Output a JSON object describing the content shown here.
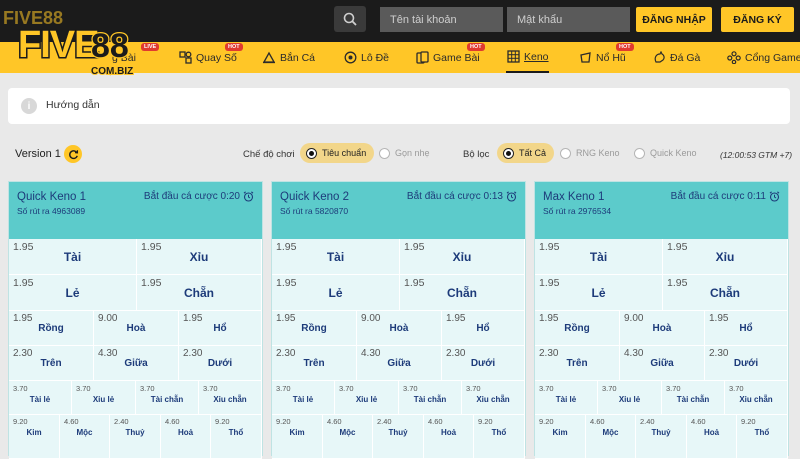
{
  "brand": {
    "logo_text": "FIVE88",
    "logo_domain": "COM.BIZ"
  },
  "header": {
    "username_placeholder": "Tên tài khoản",
    "password_placeholder": "Mật khẩu",
    "login_label": "ĐĂNG NHẬP",
    "register_label": "ĐĂNG KÝ"
  },
  "nav": {
    "items": [
      {
        "label": "g Bài",
        "icon": "cards-icon",
        "badge": "LIVE"
      },
      {
        "label": "Quay Số",
        "icon": "lottery-icon",
        "badge": "HOT"
      },
      {
        "label": "Bắn Cá",
        "icon": "fish-icon"
      },
      {
        "label": "Lô Đề",
        "icon": "lotto-ball-icon"
      },
      {
        "label": "Game Bài",
        "icon": "card-game-icon",
        "badge": "HOT"
      },
      {
        "label": "Keno",
        "icon": "keno-grid-icon",
        "active": true
      },
      {
        "label": "Nổ Hũ",
        "icon": "slot-icon",
        "badge": "HOT"
      },
      {
        "label": "Đá Gà",
        "icon": "rooster-icon"
      },
      {
        "label": "Cổng Game",
        "icon": "gamepad-icon"
      }
    ]
  },
  "guide": {
    "label": "Hướng dẫn",
    "icon": "info-icon"
  },
  "filters": {
    "version_label": "Version 1",
    "mode_label": "Chế độ chơi",
    "mode_options": [
      "Tiêu chuẩn",
      "Gọn nhẹ"
    ],
    "mode_selected": "Tiêu chuẩn",
    "filter_label": "Bộ lọc",
    "filter_options": [
      "Tất Cả",
      "RNG Keno",
      "Quick Keno"
    ],
    "filter_selected": "Tất Cả",
    "clock": "(12:00:53 GTM +7)"
  },
  "colors": {
    "accent": "#ffc627",
    "header_bg": "#1b1b1b",
    "card_head": "#5ccbcb",
    "card_body": "#e7f7f8",
    "label_text": "#1d3b7a",
    "badge_red": "#e03a2f"
  },
  "games": [
    {
      "name": "Quick Keno 1",
      "draw": "Số rút ra 4963089",
      "timer": "Bắt đầu cá cược 0:20",
      "row1": [
        {
          "odd": "1.95",
          "label": "Tài"
        },
        {
          "odd": "1.95",
          "label": "Xỉu"
        }
      ],
      "row2": [
        {
          "odd": "1.95",
          "label": "Lẻ"
        },
        {
          "odd": "1.95",
          "label": "Chẵn"
        }
      ],
      "row3": [
        {
          "odd": "1.95",
          "label": "Rồng"
        },
        {
          "odd": "9.00",
          "label": "Hoà"
        },
        {
          "odd": "1.95",
          "label": "Hổ"
        }
      ],
      "row4": [
        {
          "odd": "2.30",
          "label": "Trên"
        },
        {
          "odd": "4.30",
          "label": "Giữa"
        },
        {
          "odd": "2.30",
          "label": "Dưới"
        }
      ],
      "row5": [
        {
          "odd": "3.70",
          "label": "Tài lẻ"
        },
        {
          "odd": "3.70",
          "label": "Xỉu lẻ"
        },
        {
          "odd": "3.70",
          "label": "Tài chẵn"
        },
        {
          "odd": "3.70",
          "label": "Xỉu chẵn"
        }
      ],
      "row6": [
        {
          "odd": "9.20",
          "label": "Kim"
        },
        {
          "odd": "4.60",
          "label": "Mộc"
        },
        {
          "odd": "2.40",
          "label": "Thuỷ"
        },
        {
          "odd": "4.60",
          "label": "Hoả"
        },
        {
          "odd": "9.20",
          "label": "Thổ"
        }
      ]
    },
    {
      "name": "Quick Keno 2",
      "draw": "Số rút ra 5820870",
      "timer": "Bắt đầu cá cược 0:13",
      "row1": [
        {
          "odd": "1.95",
          "label": "Tài"
        },
        {
          "odd": "1.95",
          "label": "Xỉu"
        }
      ],
      "row2": [
        {
          "odd": "1.95",
          "label": "Lẻ"
        },
        {
          "odd": "1.95",
          "label": "Chẵn"
        }
      ],
      "row3": [
        {
          "odd": "1.95",
          "label": "Rồng"
        },
        {
          "odd": "9.00",
          "label": "Hoà"
        },
        {
          "odd": "1.95",
          "label": "Hổ"
        }
      ],
      "row4": [
        {
          "odd": "2.30",
          "label": "Trên"
        },
        {
          "odd": "4.30",
          "label": "Giữa"
        },
        {
          "odd": "2.30",
          "label": "Dưới"
        }
      ],
      "row5": [
        {
          "odd": "3.70",
          "label": "Tài lẻ"
        },
        {
          "odd": "3.70",
          "label": "Xỉu lẻ"
        },
        {
          "odd": "3.70",
          "label": "Tài chẵn"
        },
        {
          "odd": "3.70",
          "label": "Xỉu chẵn"
        }
      ],
      "row6": [
        {
          "odd": "9.20",
          "label": "Kim"
        },
        {
          "odd": "4.60",
          "label": "Mộc"
        },
        {
          "odd": "2.40",
          "label": "Thuỷ"
        },
        {
          "odd": "4.60",
          "label": "Hoả"
        },
        {
          "odd": "9.20",
          "label": "Thổ"
        }
      ]
    },
    {
      "name": "Max Keno 1",
      "draw": "Số rút ra 2976534",
      "timer": "Bắt đầu cá cược 0:11",
      "row1": [
        {
          "odd": "1.95",
          "label": "Tài"
        },
        {
          "odd": "1.95",
          "label": "Xỉu"
        }
      ],
      "row2": [
        {
          "odd": "1.95",
          "label": "Lẻ"
        },
        {
          "odd": "1.95",
          "label": "Chẵn"
        }
      ],
      "row3": [
        {
          "odd": "1.95",
          "label": "Rồng"
        },
        {
          "odd": "9.00",
          "label": "Hoà"
        },
        {
          "odd": "1.95",
          "label": "Hổ"
        }
      ],
      "row4": [
        {
          "odd": "2.30",
          "label": "Trên"
        },
        {
          "odd": "4.30",
          "label": "Giữa"
        },
        {
          "odd": "2.30",
          "label": "Dưới"
        }
      ],
      "row5": [
        {
          "odd": "3.70",
          "label": "Tài lẻ"
        },
        {
          "odd": "3.70",
          "label": "Xỉu lẻ"
        },
        {
          "odd": "3.70",
          "label": "Tài chẵn"
        },
        {
          "odd": "3.70",
          "label": "Xỉu chẵn"
        }
      ],
      "row6": [
        {
          "odd": "9.20",
          "label": "Kim"
        },
        {
          "odd": "4.60",
          "label": "Mộc"
        },
        {
          "odd": "2.40",
          "label": "Thuỷ"
        },
        {
          "odd": "4.60",
          "label": "Hoả"
        },
        {
          "odd": "9.20",
          "label": "Thổ"
        }
      ]
    }
  ]
}
